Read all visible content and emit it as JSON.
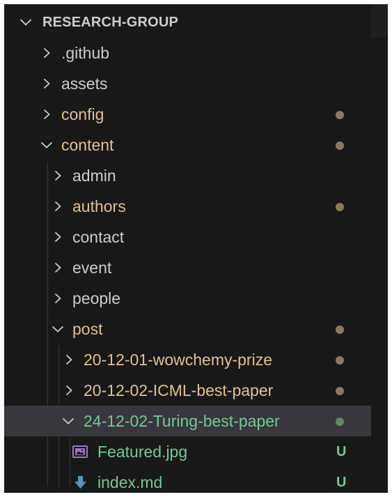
{
  "colors": {
    "background": "#181818",
    "folder_default": "#cccccc",
    "folder_modified": "#e2c08d",
    "untracked": "#73c991",
    "dot_modified": "#8c7b5b",
    "dot_untracked": "#5c8a63",
    "image_icon": "#a074c4",
    "markdown_icon": "#519aba"
  },
  "explorer": {
    "root_label": "RESEARCH-GROUP",
    "items": [
      {
        "label": ".github",
        "state": "collapsed",
        "kind": "folder",
        "git": "none"
      },
      {
        "label": "assets",
        "state": "collapsed",
        "kind": "folder",
        "git": "none"
      },
      {
        "label": "config",
        "state": "collapsed",
        "kind": "folder",
        "git": "modified"
      },
      {
        "label": "content",
        "state": "expanded",
        "kind": "folder",
        "git": "modified"
      },
      {
        "label": "admin",
        "state": "collapsed",
        "kind": "folder",
        "git": "none"
      },
      {
        "label": "authors",
        "state": "collapsed",
        "kind": "folder",
        "git": "modified"
      },
      {
        "label": "contact",
        "state": "collapsed",
        "kind": "folder",
        "git": "none"
      },
      {
        "label": "event",
        "state": "collapsed",
        "kind": "folder",
        "git": "none"
      },
      {
        "label": "people",
        "state": "collapsed",
        "kind": "folder",
        "git": "none"
      },
      {
        "label": "post",
        "state": "expanded",
        "kind": "folder",
        "git": "modified"
      },
      {
        "label": "20-12-01-wowchemy-prize",
        "state": "collapsed",
        "kind": "folder",
        "git": "modified"
      },
      {
        "label": "20-12-02-ICML-best-paper",
        "state": "collapsed",
        "kind": "folder",
        "git": "modified"
      },
      {
        "label": "24-12-02-Turing-best-paper",
        "state": "expanded",
        "kind": "folder",
        "git": "untracked",
        "selected": true
      },
      {
        "label": "Featured.jpg",
        "kind": "file",
        "icon": "image-file-icon",
        "git": "untracked",
        "status": "U"
      },
      {
        "label": "index.md",
        "kind": "file",
        "icon": "markdown-download-icon",
        "git": "untracked",
        "status": "U"
      }
    ]
  }
}
